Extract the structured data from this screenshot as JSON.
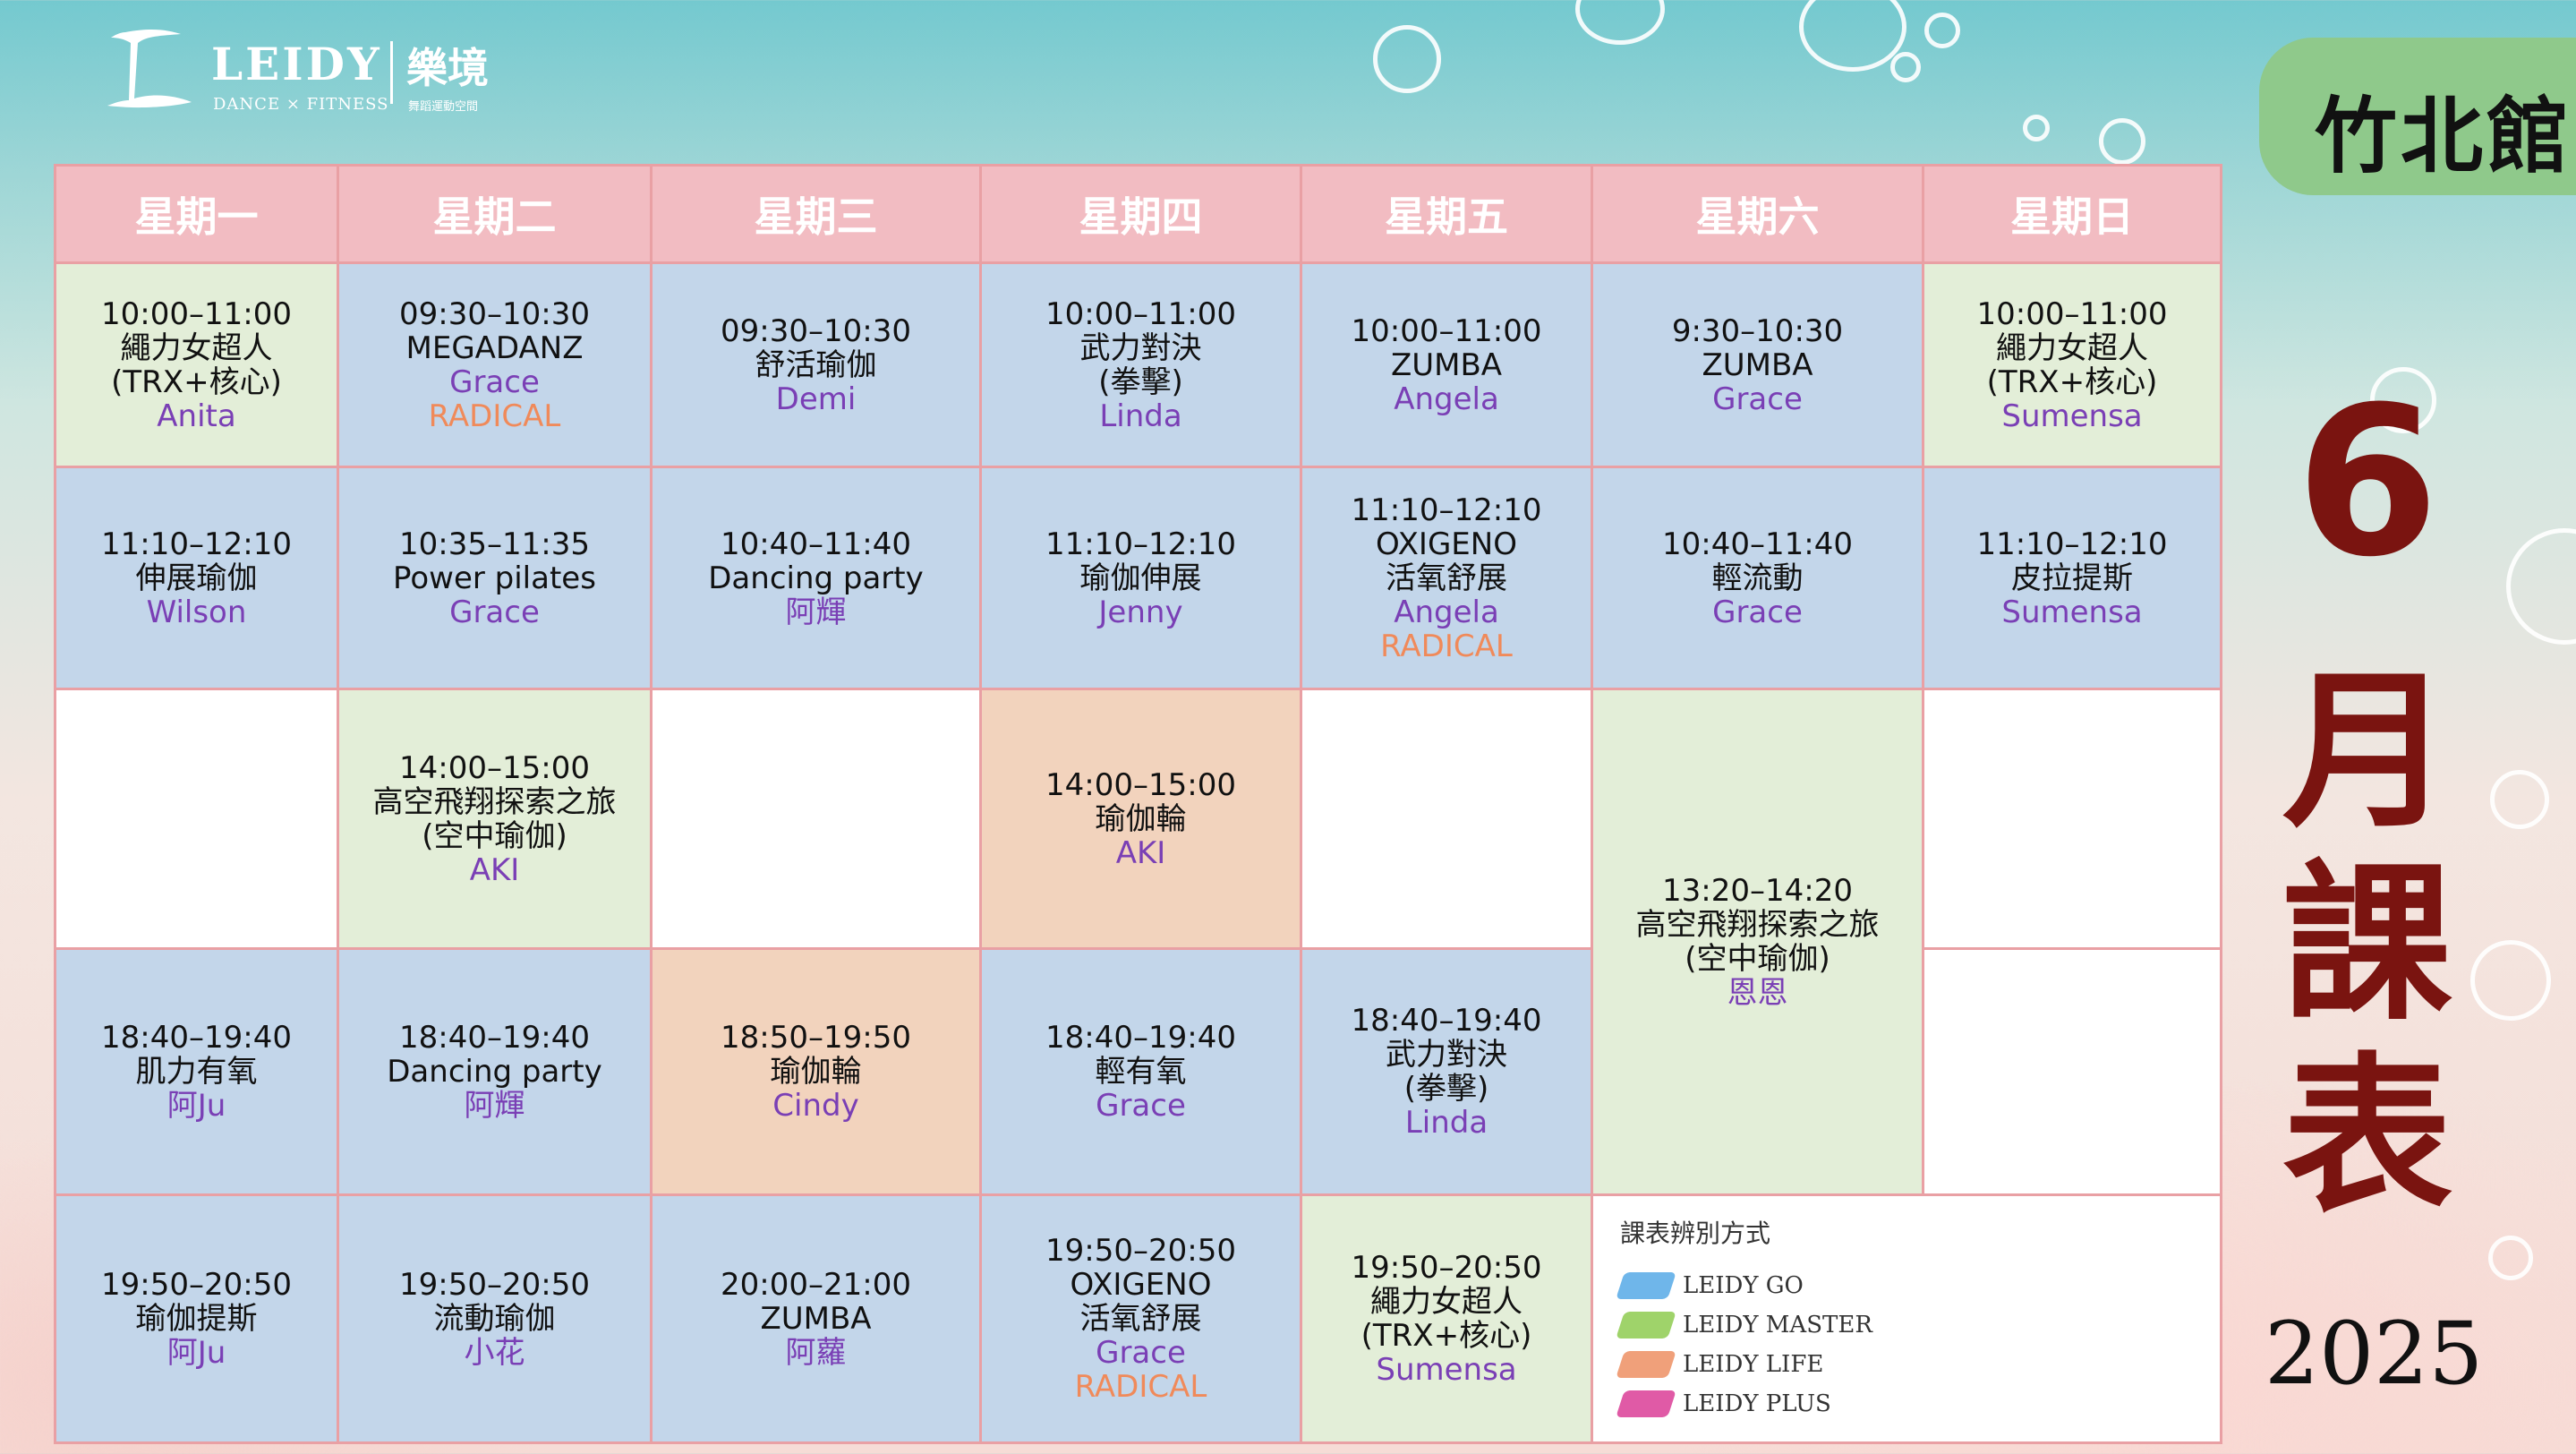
{
  "logo": {
    "name": "LEIDY",
    "chinese": "樂境",
    "sub": "DANCE × FITNESS",
    "sub_cn": "舞蹈運動空間"
  },
  "branch": "竹北館",
  "month_label": {
    "number": "6",
    "chars": [
      "月",
      "課",
      "表"
    ]
  },
  "year": "2025",
  "days": [
    "星期一",
    "星期二",
    "星期三",
    "星期四",
    "星期五",
    "星期六",
    "星期日"
  ],
  "rows": [
    [
      {
        "time": "10:00–11:00",
        "name": [
          "繩力女超人",
          "(TRX+核心)"
        ],
        "instructor": "Anita",
        "color": "green"
      },
      {
        "time": "09:30–10:30",
        "name": [
          "MEGADANZ"
        ],
        "instructor": "Grace",
        "tag": "RADICAL",
        "color": "blue"
      },
      {
        "time": "09:30–10:30",
        "name": [
          "舒活瑜伽"
        ],
        "instructor": "Demi",
        "color": "blue"
      },
      {
        "time": "10:00–11:00",
        "name": [
          "武力對決",
          "(拳擊)"
        ],
        "instructor": "Linda",
        "color": "blue"
      },
      {
        "time": "10:00–11:00",
        "name": [
          "ZUMBA"
        ],
        "instructor": "Angela",
        "color": "blue"
      },
      {
        "time": "9:30–10:30",
        "name": [
          "ZUMBA"
        ],
        "instructor": "Grace",
        "color": "blue"
      },
      {
        "time": "10:00–11:00",
        "name": [
          "繩力女超人",
          "(TRX+核心)"
        ],
        "instructor": "Sumensa",
        "color": "green"
      }
    ],
    [
      {
        "time": "11:10–12:10",
        "name": [
          "伸展瑜伽"
        ],
        "instructor": "Wilson",
        "color": "blue"
      },
      {
        "time": "10:35–11:35",
        "name": [
          "Power pilates"
        ],
        "instructor": "Grace",
        "color": "blue"
      },
      {
        "time": "10:40–11:40",
        "name": [
          "Dancing party"
        ],
        "instructor": "阿輝",
        "color": "blue"
      },
      {
        "time": "11:10–12:10",
        "name": [
          "瑜伽伸展"
        ],
        "instructor": "Jenny",
        "color": "blue"
      },
      {
        "time": "11:10–12:10",
        "name": [
          "OXIGENO",
          "活氧舒展"
        ],
        "instructor": "Angela",
        "tag": "RADICAL",
        "color": "blue"
      },
      {
        "time": "10:40–11:40",
        "name": [
          "輕流動"
        ],
        "instructor": "Grace",
        "color": "blue"
      },
      {
        "time": "11:10–12:10",
        "name": [
          "皮拉提斯"
        ],
        "instructor": "Sumensa",
        "color": "blue"
      }
    ],
    [
      {
        "color": "white"
      },
      {
        "time": "14:00–15:00",
        "name": [
          "高空飛翔探索之旅",
          "(空中瑜伽)"
        ],
        "instructor": "AKI",
        "color": "green"
      },
      {
        "color": "white"
      },
      {
        "time": "14:00–15:00",
        "name": [
          "瑜伽輪"
        ],
        "instructor": "AKI",
        "color": "orange"
      },
      {
        "color": "white"
      },
      {
        "time": "13:20–14:20",
        "name": [
          "高空飛翔探索之旅",
          "(空中瑜伽)"
        ],
        "instructor": "恩恩",
        "color": "green"
      },
      {
        "color": "white"
      }
    ],
    [
      {
        "time": "18:40–19:40",
        "name": [
          "肌力有氧"
        ],
        "instructor": "阿Ju",
        "color": "blue"
      },
      {
        "time": "18:40–19:40",
        "name": [
          "Dancing party"
        ],
        "instructor": "阿輝",
        "color": "blue"
      },
      {
        "time": "18:50–19:50",
        "name": [
          "瑜伽輪"
        ],
        "instructor": "Cindy",
        "color": "orange"
      },
      {
        "time": "18:40–19:40",
        "name": [
          "輕有氧"
        ],
        "instructor": "Grace",
        "color": "blue"
      },
      {
        "time": "18:40–19:40",
        "name": [
          "武力對決",
          "(拳擊)"
        ],
        "instructor": "Linda",
        "color": "blue"
      },
      {
        "color": "white"
      }
    ],
    [
      {
        "time": "19:50–20:50",
        "name": [
          "瑜伽提斯"
        ],
        "instructor": "阿Ju",
        "color": "blue"
      },
      {
        "time": "19:50–20:50",
        "name": [
          "流動瑜伽"
        ],
        "instructor": "小花",
        "color": "blue"
      },
      {
        "time": "20:00–21:00",
        "name": [
          "ZUMBA"
        ],
        "instructor": "阿蘿",
        "color": "blue"
      },
      {
        "time": "19:50–20:50",
        "name": [
          "OXIGENO",
          "活氧舒展"
        ],
        "instructor": "Grace",
        "tag": "RADICAL",
        "color": "blue"
      },
      {
        "time": "19:50–20:50",
        "name": [
          "繩力女超人",
          "(TRX+核心)"
        ],
        "instructor": "Sumensa",
        "color": "green"
      }
    ]
  ],
  "legend": {
    "title": "課表辨別方式",
    "items": [
      {
        "label": "LEIDY GO",
        "color": "#6fb6ea"
      },
      {
        "label": "LEIDY MASTER",
        "color": "#9fd36a"
      },
      {
        "label": "LEIDY LIFE",
        "color": "#f0a07a"
      },
      {
        "label": "LEIDY PLUS",
        "color": "#e05aa6"
      }
    ]
  }
}
